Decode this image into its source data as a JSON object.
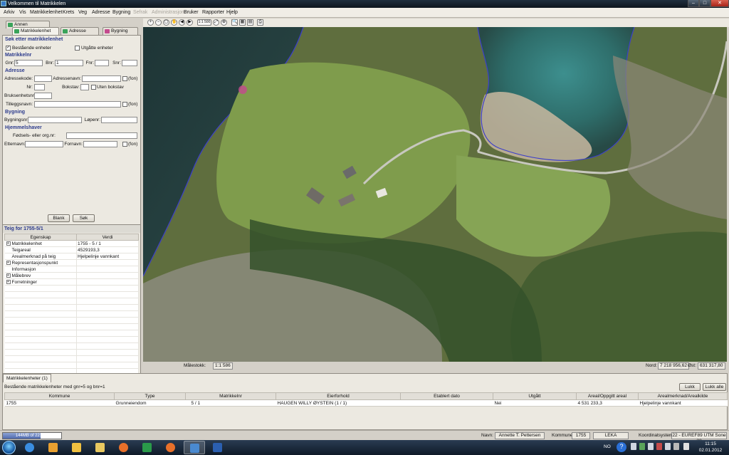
{
  "window": {
    "title": "Velkommen til Matrikkelen",
    "min_label": "–",
    "max_label": "□",
    "close_label": "✕"
  },
  "menu": [
    "Arkiv",
    "Vis",
    "Matrikkelenhet",
    "Krets",
    "Veg",
    "Adresse",
    "Bygning",
    "Sefrak",
    "Administrasjon",
    "Bruker",
    "Rapporter",
    "Hjelp"
  ],
  "menu_disabled": [
    "Sefrak",
    "Administrasjon"
  ],
  "tabs": {
    "annen_kommune": "Annen kommune",
    "matrikkelenhet": "Matrikkelenhet",
    "adresse": "Adresse",
    "bygning": "Bygning"
  },
  "search": {
    "heading": "Søk etter matrikkelenhet",
    "bestaende_label": "Bestående enheter",
    "bestaende_checked": true,
    "utgatte_label": "Utgåtte enheter",
    "utgatte_checked": false,
    "matrikkelnr_heading": "Matrikkelnr",
    "gnr_label": "Gnr:",
    "gnr_value": "5",
    "bnr_label": "Bnr:",
    "bnr_value": "1",
    "fnr_label": "Fnr:",
    "fnr_value": "",
    "snr_label": "Snr:",
    "snr_value": "",
    "adresse_heading": "Adresse",
    "adressekode_label": "Adressekode:",
    "adressenavn_label": "Adressenavn:",
    "nr_label": "Nr:",
    "bokstav_label": "Bokstav:",
    "uten_bokstav_label": "Uten bokstav",
    "bruksenhetsnr_label": "Bruksenhetsnr:",
    "tilleggsnavn_label": "Tilleggsnavn:",
    "fon_label": "(fon)",
    "bygning_heading": "Bygning",
    "bygningsnr_label": "Bygningsnr:",
    "lopenr_label": "Løpenr:",
    "hjemmelshaver_heading": "Hjemmelshaver",
    "fodsels_label": "Fødsels- eller org.nr:",
    "etternavn_label": "Etternavn:",
    "fornavn_label": "Fornavn:",
    "blank_button": "Blank",
    "sok_button": "Søk"
  },
  "teig": {
    "title": "Teig for 1755-5/1",
    "col_egenskap": "Egenskap",
    "col_verdi": "Verdi",
    "rows": [
      {
        "egenskap": "Matrikkelenhet",
        "verdi": "1755 - 5 / 1",
        "expand": true
      },
      {
        "egenskap": "Teigareal",
        "verdi": "4529193,3",
        "expand": false
      },
      {
        "egenskap": "Arealmerknad på teig",
        "verdi": "Hjelpelinje vannkant",
        "expand": false
      },
      {
        "egenskap": "Representasjonspunkt",
        "verdi": "",
        "expand": true
      },
      {
        "egenskap": "Informasjon",
        "verdi": "",
        "expand": false
      },
      {
        "egenskap": "Målebrev",
        "verdi": "",
        "expand": true
      },
      {
        "egenskap": "Forretninger",
        "verdi": "",
        "expand": true
      }
    ]
  },
  "toolbar_icons": [
    "zoom-in-icon",
    "zoom-out-icon",
    "zoom-box-icon",
    "pan-icon",
    "previous-view-icon",
    "next-view-icon",
    "scale-icon",
    "full-extent-icon",
    "center-icon",
    "search-map-icon",
    "legend-icon",
    "layers-icon",
    "print-icon"
  ],
  "toolbar_scale_text": "1:1 500",
  "map_status": {
    "malestokk_label": "Målestokk:",
    "malestokk_value": "1:1 586",
    "nord_label": "Nord:",
    "nord_value": "7 218 956,62",
    "ost_label": "Øst:",
    "ost_value": "631 317,80"
  },
  "results": {
    "tab_label": "Matrikkelenheter (1)",
    "summary": "Bestående matrikkelenheter med gnr=5 og  bnr=1",
    "lukk_button": "Lukk",
    "lukk_alle_button": "Lukk alle",
    "columns": [
      "Kommune",
      "Type",
      "Matrikkelnr",
      "Eierforhold",
      "Etablert dato",
      "Utgått",
      "Areal/Oppgitt areal",
      "Arealmerknad/Arealkilde"
    ],
    "rows": [
      [
        "1755",
        "Grunneiendom",
        "5 / 1",
        "HAUGEN WILLY ØYSTEIN (1 / 1)",
        "",
        "Nei",
        "4 531 233,3",
        "Hjelpelinje vannkant"
      ]
    ]
  },
  "status": {
    "memory_text": "144MB of 221MB",
    "memory_fraction": 0.65,
    "navn_label": "Navn:",
    "navn_value": "Annette T. Pettersen",
    "kommune_label": "Kommune:",
    "kommune_code": "1755",
    "kommune_name": "LEKA",
    "koord_label": "Koordinatsystem:",
    "koord_value": "22 - EUREF89 UTM Sone 32"
  },
  "taskbar": {
    "apps": [
      "internet-explorer-icon",
      "media-player-icon",
      "file-explorer-icon",
      "folder-icon",
      "firefox-icon",
      "phone-icon",
      "firefox-icon",
      "matrikkel-app-icon",
      "word-icon"
    ],
    "lang": "NO",
    "time": "11:15",
    "date": "02.01.2012"
  },
  "colors": {
    "section_heading": "#2b3a8c",
    "shoreline": "#3d3fc9",
    "water": "#1f3b3d"
  }
}
